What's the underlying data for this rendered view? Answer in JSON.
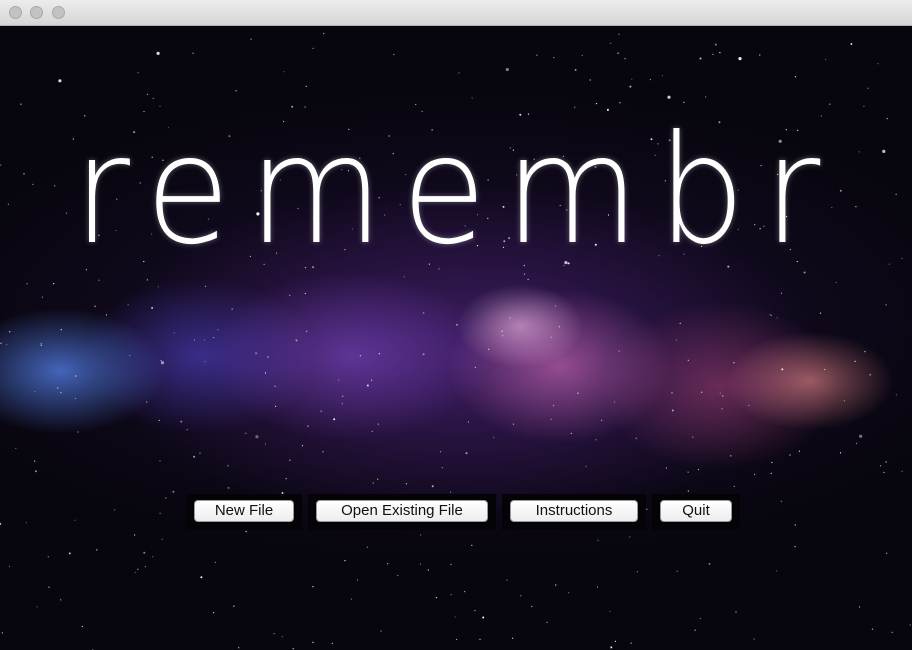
{
  "window": {
    "controls": [
      "close",
      "minimize",
      "zoom"
    ]
  },
  "app": {
    "title": "remembr"
  },
  "buttons": {
    "new_file": "New File",
    "open_existing_file": "Open Existing File",
    "instructions": "Instructions",
    "quit": "Quit"
  },
  "colors": {
    "title_text": "#ffffff",
    "button_bg": "#f4f4f4",
    "background": "#07050d"
  }
}
